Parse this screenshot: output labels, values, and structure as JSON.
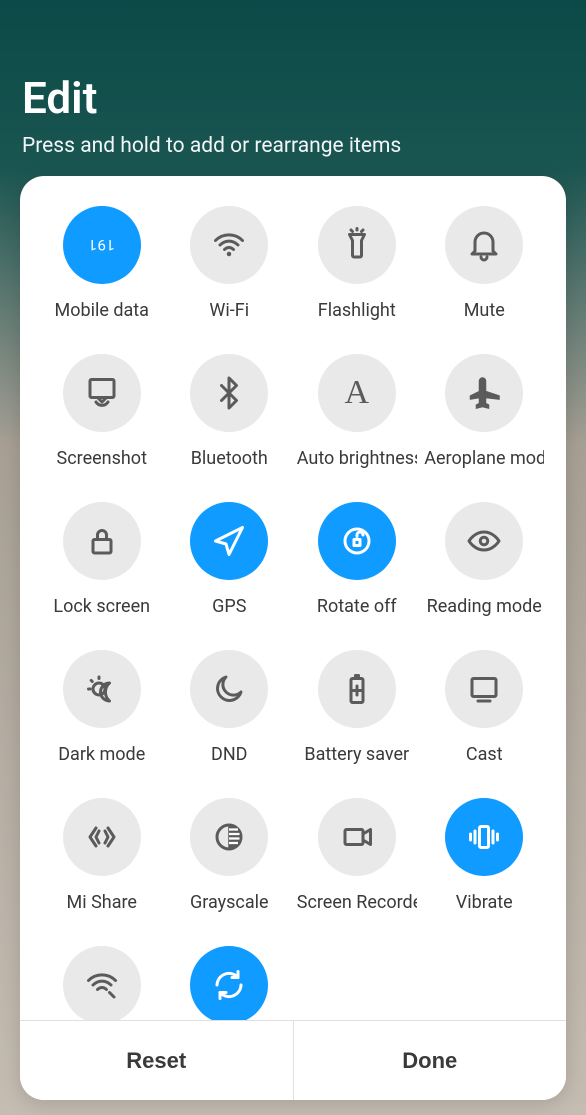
{
  "header": {
    "title": "Edit",
    "subtitle": "Press and hold to add or rearrange items"
  },
  "tiles": [
    {
      "id": "mobile-data",
      "label": "Mobile data",
      "active": true,
      "icon": "mobile-data"
    },
    {
      "id": "wifi",
      "label": "Wi-Fi",
      "active": false,
      "icon": "wifi"
    },
    {
      "id": "flashlight",
      "label": "Flashlight",
      "active": false,
      "icon": "flashlight"
    },
    {
      "id": "mute",
      "label": "Mute",
      "active": false,
      "icon": "bell"
    },
    {
      "id": "screenshot",
      "label": "Screenshot",
      "active": false,
      "icon": "screenshot"
    },
    {
      "id": "bluetooth",
      "label": "Bluetooth",
      "active": false,
      "icon": "bluetooth"
    },
    {
      "id": "auto-brightness",
      "label": "Auto brightness",
      "active": false,
      "icon": "letter-a"
    },
    {
      "id": "aeroplane",
      "label": "Aeroplane mode",
      "active": false,
      "icon": "airplane"
    },
    {
      "id": "lock-screen",
      "label": "Lock screen",
      "active": false,
      "icon": "lock"
    },
    {
      "id": "gps",
      "label": "GPS",
      "active": true,
      "icon": "location"
    },
    {
      "id": "rotate-off",
      "label": "Rotate off",
      "active": true,
      "icon": "rotate-lock"
    },
    {
      "id": "reading-mode",
      "label": "Reading mode",
      "active": false,
      "icon": "eye"
    },
    {
      "id": "dark-mode",
      "label": "Dark mode",
      "active": false,
      "icon": "dark-mode"
    },
    {
      "id": "dnd",
      "label": "DND",
      "active": false,
      "icon": "moon"
    },
    {
      "id": "battery-saver",
      "label": "Battery saver",
      "active": false,
      "icon": "battery"
    },
    {
      "id": "cast",
      "label": "Cast",
      "active": false,
      "icon": "cast"
    },
    {
      "id": "mi-share",
      "label": "Mi Share",
      "active": false,
      "icon": "mishare"
    },
    {
      "id": "grayscale",
      "label": "Grayscale",
      "active": false,
      "icon": "grayscale"
    },
    {
      "id": "screen-recorder",
      "label": "Screen Recorder",
      "active": false,
      "icon": "camera"
    },
    {
      "id": "vibrate",
      "label": "Vibrate",
      "active": true,
      "icon": "vibrate"
    },
    {
      "id": "hotspot",
      "label": "",
      "active": false,
      "icon": "hotspot"
    },
    {
      "id": "sync",
      "label": "",
      "active": true,
      "icon": "sync"
    }
  ],
  "footer": {
    "reset": "Reset",
    "done": "Done"
  },
  "colors": {
    "accent": "#0f9bff",
    "tileOff": "#e9e9ea"
  }
}
